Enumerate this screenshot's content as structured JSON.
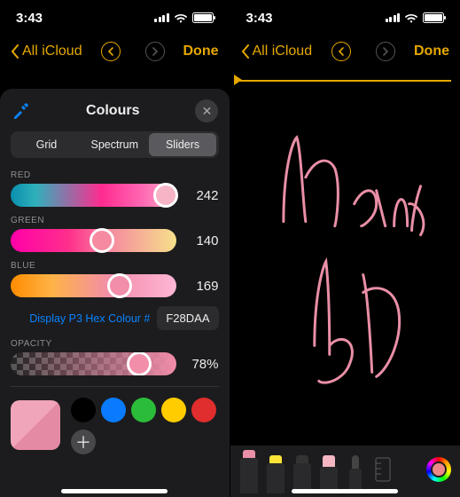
{
  "status": {
    "time": "3:43"
  },
  "nav": {
    "back_label": "All iCloud",
    "done_label": "Done"
  },
  "panel": {
    "title": "Colours",
    "tabs": {
      "grid": "Grid",
      "spectrum": "Spectrum",
      "sliders": "Sliders",
      "active": "sliders"
    },
    "sliders": {
      "red": {
        "label": "RED",
        "value": 242,
        "pct": 94
      },
      "green": {
        "label": "GREEN",
        "value": 140,
        "pct": 55
      },
      "blue": {
        "label": "BLUE",
        "value": 169,
        "pct": 66
      }
    },
    "hex_label": "Display P3 Hex Colour #",
    "hex_value": "F28DAA",
    "opacity": {
      "label": "OPACITY",
      "value": "78%",
      "pct": 78
    },
    "current_color": "#F28DAA",
    "presets": [
      "#000000",
      "#0a7bff",
      "#2bbd3a",
      "#ffcc00",
      "#e02d2d"
    ]
  },
  "right": {
    "handwriting_text": "Mark up",
    "tools": [
      "pen",
      "highlighter",
      "pencil",
      "eraser",
      "lasso",
      "ruler"
    ]
  }
}
